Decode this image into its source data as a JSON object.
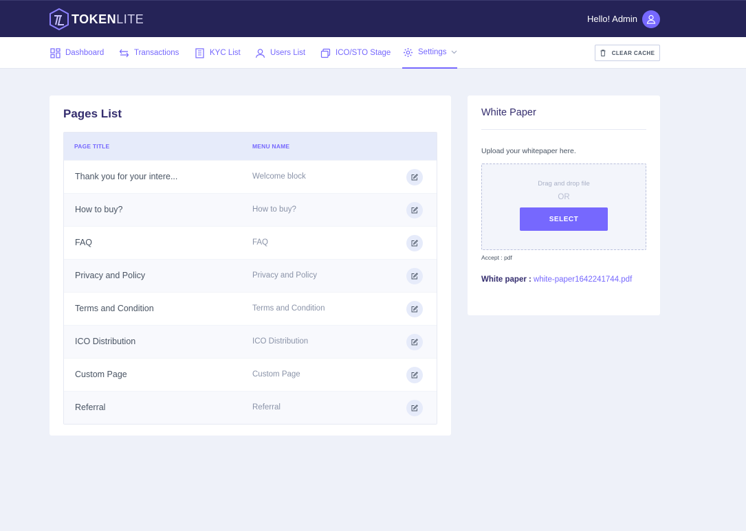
{
  "app": {
    "logo_bold": "TOKEN",
    "logo_thin": "LITE",
    "greeting": "Hello! Admin"
  },
  "nav": {
    "dashboard": "Dashboard",
    "transactions": "Transactions",
    "kyc": "KYC List",
    "users": "Users List",
    "ico": "ICO/STO Stage",
    "settings": "Settings",
    "clear_cache": "CLEAR CACHE"
  },
  "pages": {
    "title": "Pages List",
    "col_title": "PAGE TITLE",
    "col_menu": "MENU NAME",
    "rows": [
      {
        "title": "Thank you for your intere...",
        "menu": "Welcome block"
      },
      {
        "title": "How to buy?",
        "menu": "How to buy?"
      },
      {
        "title": "FAQ",
        "menu": "FAQ"
      },
      {
        "title": "Privacy and Policy",
        "menu": "Privacy and Policy"
      },
      {
        "title": "Terms and Condition",
        "menu": "Terms and Condition"
      },
      {
        "title": "ICO Distribution",
        "menu": "ICO Distribution"
      },
      {
        "title": "Custom Page",
        "menu": "Custom Page"
      },
      {
        "title": "Referral",
        "menu": "Referral"
      }
    ]
  },
  "white_paper": {
    "title": "White Paper",
    "hint": "Upload your whitepaper here.",
    "drag": "Drag and drop file",
    "or": "OR",
    "select": "SELECT",
    "accept": "Accept : pdf",
    "file_label": "White paper :",
    "file_name": "white-paper1642241744.pdf"
  },
  "colors": {
    "topbar": "#252357",
    "accent": "#7668fe",
    "background": "#eef1f9"
  }
}
